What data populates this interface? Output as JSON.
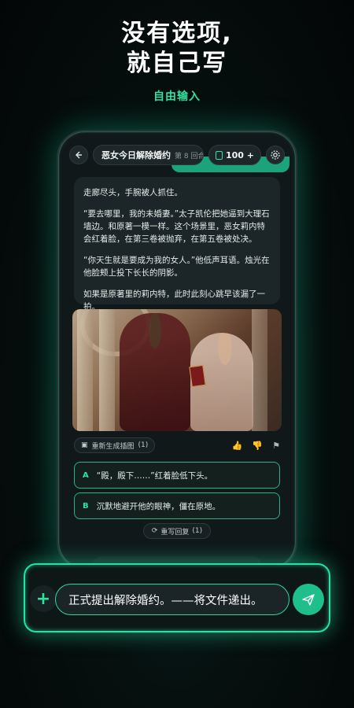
{
  "promo": {
    "headline_line1": "没有选项,",
    "headline_line2": "就自己写",
    "subhead": "自由输入"
  },
  "chat": {
    "title": "恶女今日解除婚约",
    "round": "第 8 回合",
    "credits": "100 +",
    "story": [
      "走廊尽头，手腕被人抓住。",
      "“要去哪里，我的未婚妻。”太子凯伦把她逼到大理石墙边。和原著一模一样。这个场景里，恶女莉内特会红着脸，在第三卷被抛弃，在第五卷被处决。",
      "“你天生就是要成为我的女人。”他低声耳语。烛光在他脸颊上投下长长的阴影。",
      "如果是原著里的莉内特，此时此刻心跳早该漏了一拍。"
    ],
    "regen_image_label": "重新生成插图",
    "regen_image_count": "(1)",
    "options": [
      {
        "key": "A",
        "text": "“殿，殿下……”红着脸低下头。"
      },
      {
        "key": "B",
        "text": "沉默地避开他的眼神，僵在原地。"
      }
    ],
    "rewrite_label": "重写回复",
    "rewrite_count": "(1)"
  },
  "composer": {
    "value": "正式提出解除婚约。——将文件递出。"
  },
  "colors": {
    "accent": "#2ee3a0",
    "background": "#06100f"
  }
}
